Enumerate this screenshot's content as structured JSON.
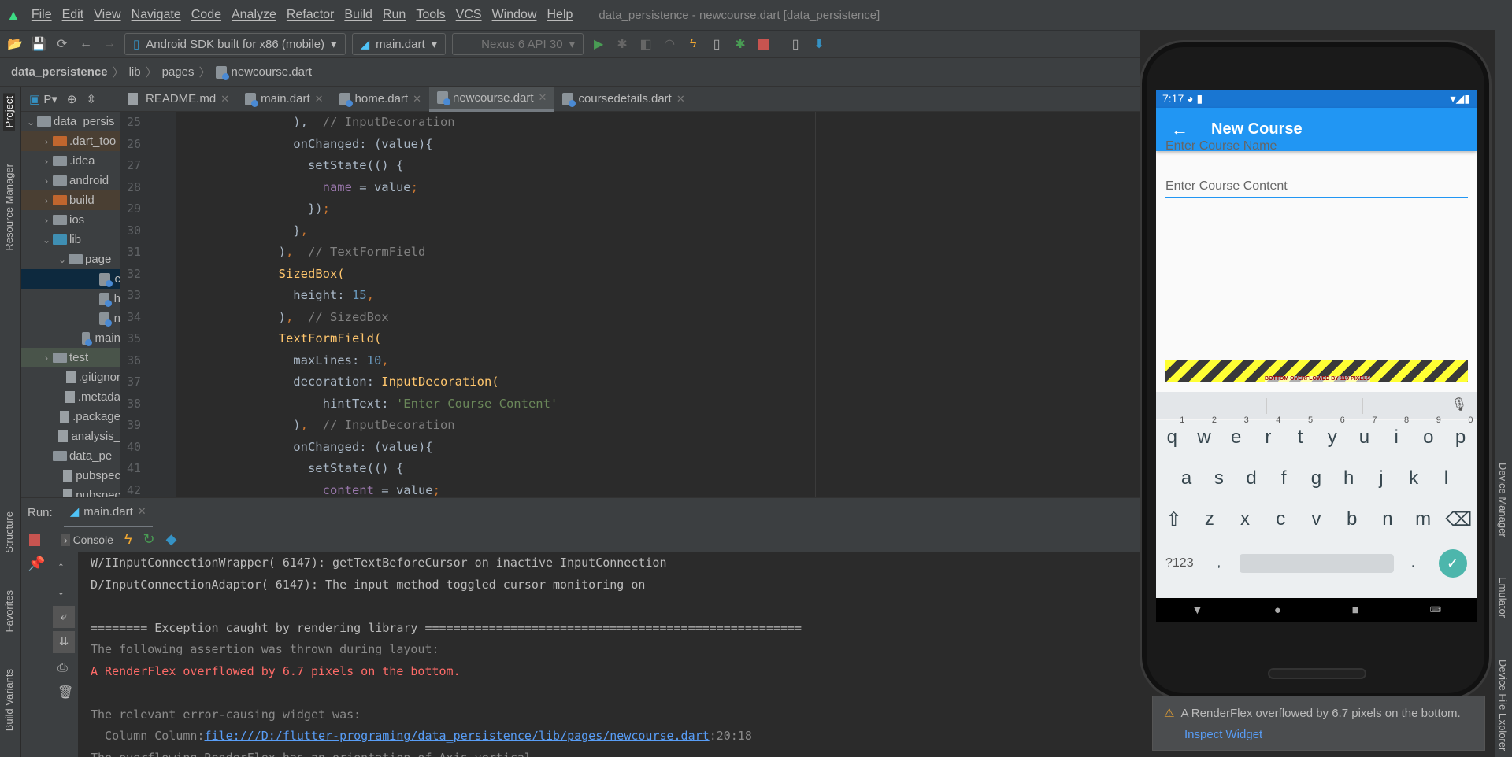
{
  "menu": {
    "items": [
      "File",
      "Edit",
      "View",
      "Navigate",
      "Code",
      "Analyze",
      "Refactor",
      "Build",
      "Run",
      "Tools",
      "VCS",
      "Window",
      "Help"
    ],
    "title": "data_persistence - newcourse.dart [data_persistence]"
  },
  "toolbar": {
    "device": "Android SDK built for x86 (mobile)",
    "config": "main.dart",
    "avd": "Nexus 6 API 30"
  },
  "breadcrumb": [
    "data_persistence",
    "lib",
    "pages",
    "newcourse.dart"
  ],
  "project_tool": "P",
  "tabs": [
    {
      "label": "README.md"
    },
    {
      "label": "main.dart"
    },
    {
      "label": "home.dart"
    },
    {
      "label": "newcourse.dart",
      "active": true
    },
    {
      "label": "coursedetails.dart"
    }
  ],
  "left_strip": [
    "Project",
    "Resource Manager",
    "Structure",
    "Favorites",
    "Build Variants"
  ],
  "tree": [
    {
      "label": "data_persis",
      "indent": 0,
      "chev": "v",
      "type": "folder"
    },
    {
      "label": ".dart_too",
      "indent": 1,
      "chev": ">",
      "type": "orange"
    },
    {
      "label": ".idea",
      "indent": 1,
      "chev": ">",
      "type": "folder"
    },
    {
      "label": "android",
      "indent": 1,
      "chev": ">",
      "type": "folder"
    },
    {
      "label": "build",
      "indent": 1,
      "chev": ">",
      "type": "orange"
    },
    {
      "label": "ios",
      "indent": 1,
      "chev": ">",
      "type": "folder"
    },
    {
      "label": "lib",
      "indent": 1,
      "chev": "v",
      "type": "blue"
    },
    {
      "label": "page",
      "indent": 2,
      "chev": "v",
      "type": "folder"
    },
    {
      "label": "c",
      "indent": 4,
      "chev": "",
      "type": "dart",
      "selected": true
    },
    {
      "label": "h",
      "indent": 4,
      "chev": "",
      "type": "dart"
    },
    {
      "label": "n",
      "indent": 4,
      "chev": "",
      "type": "dart"
    },
    {
      "label": "main",
      "indent": 3,
      "chev": "",
      "type": "dart"
    },
    {
      "label": "test",
      "indent": 1,
      "chev": ">",
      "type": "folder",
      "test": true
    },
    {
      "label": ".gitignor",
      "indent": 2,
      "chev": "",
      "type": "file"
    },
    {
      "label": ".metada",
      "indent": 2,
      "chev": "",
      "type": "file"
    },
    {
      "label": ".package",
      "indent": 2,
      "chev": "",
      "type": "file"
    },
    {
      "label": "analysis_",
      "indent": 2,
      "chev": "",
      "type": "file"
    },
    {
      "label": "data_pe",
      "indent": 1,
      "chev": "",
      "type": "folder"
    },
    {
      "label": "pubspec",
      "indent": 2,
      "chev": "",
      "type": "file"
    },
    {
      "label": "pubspec",
      "indent": 2,
      "chev": "",
      "type": "file"
    }
  ],
  "code": {
    "lines": [
      {
        "n": "25",
        "html": "                ),  <span class='cm'>// InputDecoration</span>"
      },
      {
        "n": "26",
        "html": "                onChanged: (value){"
      },
      {
        "n": "27",
        "html": "                  setState(() {"
      },
      {
        "n": "28",
        "html": "                    <span class='pv'>name</span> = value<span class='pn'>;</span>"
      },
      {
        "n": "29",
        "html": "                  })<span class='pn'>;</span>"
      },
      {
        "n": "30",
        "html": "                }<span class='pn'>,</span>"
      },
      {
        "n": "31",
        "html": "              )<span class='pn'>,</span>  <span class='cm'>// TextFormField</span>"
      },
      {
        "n": "32",
        "html": "              <span class='kw'>SizedBox(</span>"
      },
      {
        "n": "33",
        "html": "                height: <span class='num'>15</span><span class='pn'>,</span>"
      },
      {
        "n": "34",
        "html": "              )<span class='pn'>,</span>  <span class='cm'>// SizedBox</span>"
      },
      {
        "n": "35",
        "html": "              <span class='kw'>TextFormField(</span>"
      },
      {
        "n": "36",
        "html": "                maxLines: <span class='num'>10</span><span class='pn'>,</span>"
      },
      {
        "n": "37",
        "html": "                decoration: <span class='kw'>InputDecoration(</span>"
      },
      {
        "n": "38",
        "html": "                    hintText: <span class='str'>'Enter Course Content'</span>"
      },
      {
        "n": "39",
        "html": "                )<span class='pn'>,</span>  <span class='cm'>// InputDecoration</span>"
      },
      {
        "n": "40",
        "html": "                onChanged: (value){"
      },
      {
        "n": "41",
        "html": "                  setState(() {"
      },
      {
        "n": "42",
        "html": "                    <span class='pv'>content</span> = value<span class='pn'>;</span>"
      }
    ]
  },
  "run": {
    "label": "Run:",
    "tab": "main.dart",
    "console": "Console"
  },
  "console": [
    {
      "t": "W/IInputConnectionWrapper( 6147): getTextBeforeCursor on inactive InputConnection",
      "c": ""
    },
    {
      "t": "D/InputConnectionAdaptor( 6147): The input method toggled cursor monitoring on",
      "c": ""
    },
    {
      "t": "",
      "c": ""
    },
    {
      "t": "======== Exception caught by rendering library =====================================================",
      "c": ""
    },
    {
      "t": "The following assertion was thrown during layout:",
      "c": "grey"
    },
    {
      "t": "A RenderFlex overflowed by 6.7 pixels on the bottom.",
      "c": "red"
    },
    {
      "t": "",
      "c": ""
    },
    {
      "t": "The relevant error-causing widget was:",
      "c": "grey"
    }
  ],
  "console_link": {
    "prefix": "  Column Column:",
    "link": "file:///D:/flutter-programing/data_persistence/lib/pages/newcourse.dart",
    "suffix": ":20:18"
  },
  "console_last": "The overflowing RenderFlex has an orientation of Axis.vertical.",
  "phone": {
    "time": "7:17",
    "app_title": "New Course",
    "name_hint": "Enter Course Name",
    "content_hint": "Enter Course Content",
    "overflow_text": "BOTTOM OVERFLOWED BY 119 PIXELS",
    "keyboard": {
      "row1": [
        "q",
        "w",
        "e",
        "r",
        "t",
        "y",
        "u",
        "i",
        "o",
        "p"
      ],
      "nums": [
        "1",
        "2",
        "3",
        "4",
        "5",
        "6",
        "7",
        "8",
        "9",
        "0"
      ],
      "row2": [
        "a",
        "s",
        "d",
        "f",
        "g",
        "h",
        "j",
        "k",
        "l"
      ],
      "row3": [
        "z",
        "x",
        "c",
        "v",
        "b",
        "n",
        "m"
      ],
      "sym": "?123",
      "comma": ",",
      "period": "."
    }
  },
  "right_strip": [
    "Device Manager",
    "Emulator",
    "Device File Explorer"
  ],
  "notification": {
    "message": "A RenderFlex overflowed by 6.7 pixels on the bottom.",
    "link": "Inspect Widget"
  },
  "colors": {
    "appbar": "#2196f3",
    "statusbar": "#1976d2",
    "error": "#ff6b68",
    "link": "#589df6"
  }
}
